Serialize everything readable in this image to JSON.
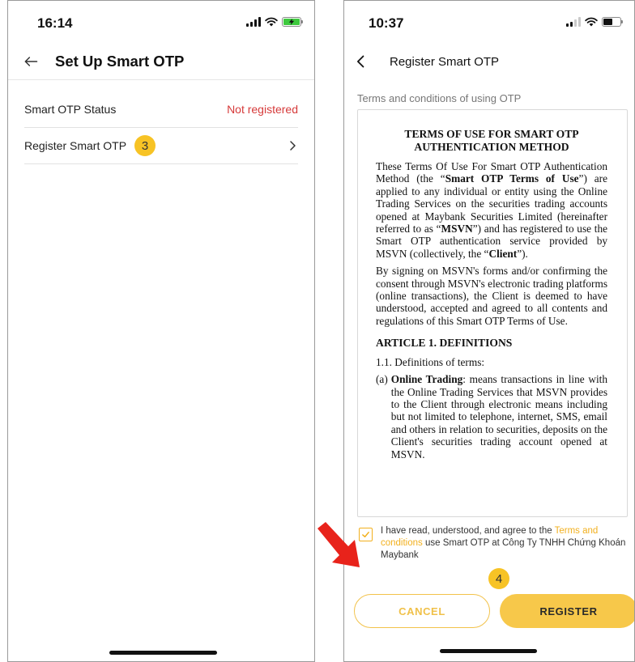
{
  "left_screen": {
    "status_time": "16:14",
    "title": "Set Up Smart OTP",
    "rows": [
      {
        "label": "Smart OTP Status",
        "value": "Not registered"
      },
      {
        "label": "Register Smart OTP",
        "badge": "3"
      }
    ]
  },
  "right_screen": {
    "status_time": "10:37",
    "title": "Register Smart OTP",
    "section_label": "Terms and conditions of using OTP",
    "terms": {
      "title_line1": "TERMS OF USE FOR SMART OTP",
      "title_line2": "AUTHENTICATION METHOD",
      "p1_a": "These Terms Of Use For Smart OTP Authentication Method (the “",
      "p1_b": "Smart OTP Terms of Use",
      "p1_c": "”) are applied to any individual or entity using the Online Trading Services on the securities trading accounts opened at Maybank Securities Limited (hereinafter referred to as “",
      "p1_d": "MSVN",
      "p1_e": "”) and has registered to use the Smart OTP authentication service provided by MSVN (collectively, the “",
      "p1_f": "Client",
      "p1_g": "”).",
      "p2": "By signing on MSVN's forms and/or confirming the consent through MSVN's electronic trading platforms (online transactions), the Client is deemed to have understood, accepted and agreed to all contents and regulations of this Smart OTP Terms of Use.",
      "article1": "ARTICLE 1. DEFINITIONS",
      "def_intro": "1.1. Definitions of terms:",
      "def_a_marker": "(a)",
      "def_a_term": "Online Trading",
      "def_a_text": ": means transactions in line with the Online Trading Services that MSVN provides to the Client through electronic means including but not limited to telephone, internet, SMS, email and others in relation to securities, deposits on the Client's securities trading account opened at MSVN."
    },
    "agree": {
      "prefix": "I have read, understood, and agree to the ",
      "link": "Terms and conditions",
      "suffix": " use Smart OTP at Công Ty TNHH Chứng Khoán Maybank"
    },
    "badge": "4",
    "cancel_label": "CANCEL",
    "register_label": "REGISTER"
  },
  "colors": {
    "accent_yellow": "#f7c84a",
    "status_red": "#d63a3a",
    "arrow_red": "#e8231b",
    "charging_green": "#3ec93e"
  }
}
